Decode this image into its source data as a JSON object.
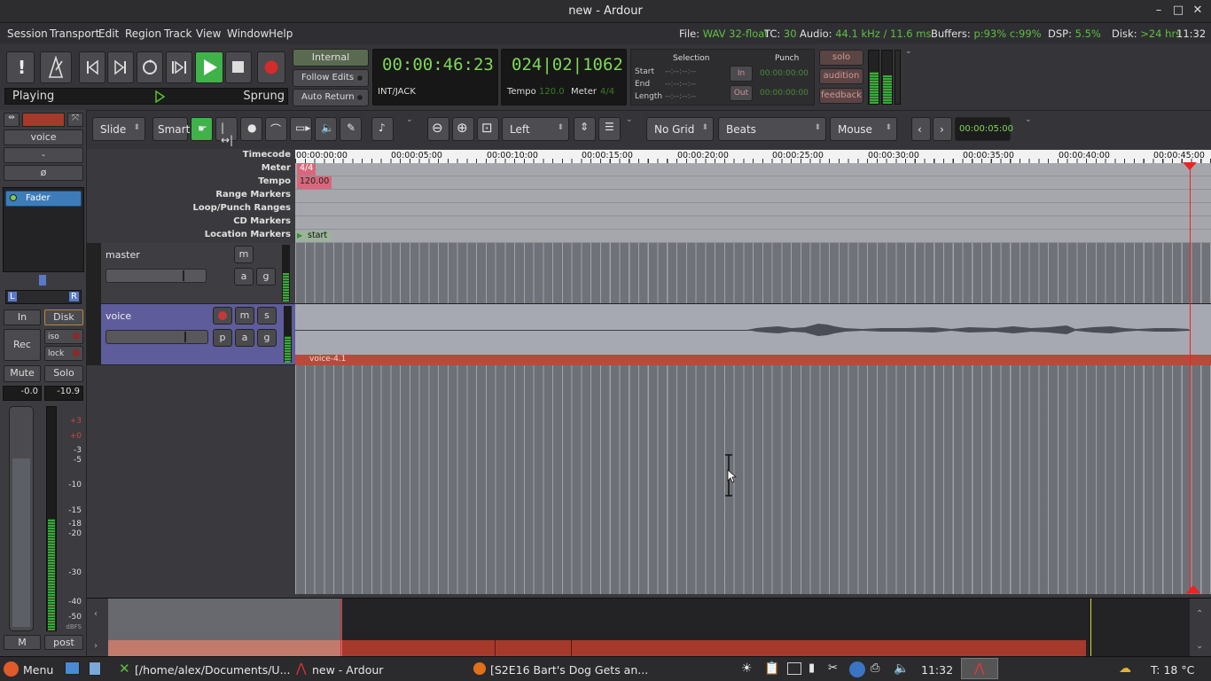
{
  "window": {
    "title": "new - Ardour",
    "min": "–",
    "max": "□",
    "close": "✕"
  },
  "menu": [
    "Session",
    "Transport",
    "Edit",
    "Region",
    "Track",
    "View",
    "Window",
    "Help"
  ],
  "status": {
    "file_label": "File:",
    "file_value": "WAV 32-float",
    "tc_label": "TC:",
    "tc_value": "30",
    "audio_label": "Audio:",
    "audio_value": "44.1 kHz / 11.6 ms",
    "buffers_label": "Buffers:",
    "buffers_value": "p:93% c:99%",
    "dsp_label": "DSP:",
    "dsp_value": "5.5%",
    "disk_label": "Disk:",
    "disk_value": ">24 hrs",
    "time": "11:32"
  },
  "transport": {
    "state": "Playing",
    "sprung": "Sprung",
    "sync_button": "Internal",
    "follow_edits": "Follow Edits",
    "auto_return": "Auto Return",
    "primary_clock": "00:00:46:23",
    "clock_source": "INT/JACK",
    "secondary_clock": "024|02|1062",
    "tempo_label": "Tempo",
    "tempo_value": "120.0",
    "meter_label": "Meter",
    "meter_value": "4/4"
  },
  "selection": {
    "title": "Selection",
    "start_label": "Start",
    "end_label": "End",
    "length_label": "Length",
    "start": "--:--:--:--",
    "end": "--:--:--:--",
    "length": "--:--:--:--"
  },
  "punch": {
    "title": "Punch",
    "in_label": "In",
    "out_label": "Out",
    "in_time": "00:00:00:00",
    "out_time": "00:00:00:00"
  },
  "monitor": {
    "solo": "solo",
    "audition": "audition",
    "feedback": "feedback"
  },
  "edit_toolbar": {
    "edit_mode": "Slide",
    "smart": "Smart",
    "zoom_focus": "Left",
    "grid": "No Grid",
    "grid_type": "Beats",
    "edit_point": "Mouse",
    "nudge_clock": "00:00:05:00"
  },
  "editor_mixer": {
    "name": "voice",
    "dash": "-",
    "phase": "ø",
    "plugin": "Fader",
    "pan_l": "L",
    "pan_r": "R",
    "in": "In",
    "disk": "Disk",
    "rec": "Rec",
    "iso": "iso",
    "lock": "lock",
    "mute": "Mute",
    "solo": "Solo",
    "gain": "-0.0",
    "peak": "-10.9",
    "scale": [
      "+3",
      "+0",
      "-3",
      "-5",
      "-10",
      "-15",
      "-18",
      "-20",
      "-30",
      "-40",
      "-50"
    ],
    "dbfs": "dBFS",
    "m": "M",
    "post": "post"
  },
  "rulers": {
    "labels": [
      "Timecode",
      "Meter",
      "Tempo",
      "Range Markers",
      "Loop/Punch Ranges",
      "CD Markers",
      "Location Markers"
    ],
    "timecodes": [
      "00:00:00:00",
      "00:00:05:00",
      "00:00:10:00",
      "00:00:15:00",
      "00:00:20:00",
      "00:00:25:00",
      "00:00:30:00",
      "00:00:35:00",
      "00:00:40:00",
      "00:00:45:00"
    ],
    "meter_marker": "4/4",
    "tempo_marker": "120.00",
    "location_marker": "start"
  },
  "tracks": [
    {
      "name": "master",
      "buttons": [
        "m",
        "a",
        "g"
      ]
    },
    {
      "name": "voice",
      "buttons": [
        "m",
        "s",
        "p",
        "a",
        "g"
      ],
      "region": "voice-4.1"
    }
  ],
  "taskbar": {
    "menu": "Menu",
    "task1": "[/home/alex/Documents/U...",
    "task2": "new - Ardour",
    "task3": "[S2E16 Bart's Dog Gets an...",
    "clock": "11:32",
    "weather": "T: 18 °C"
  }
}
